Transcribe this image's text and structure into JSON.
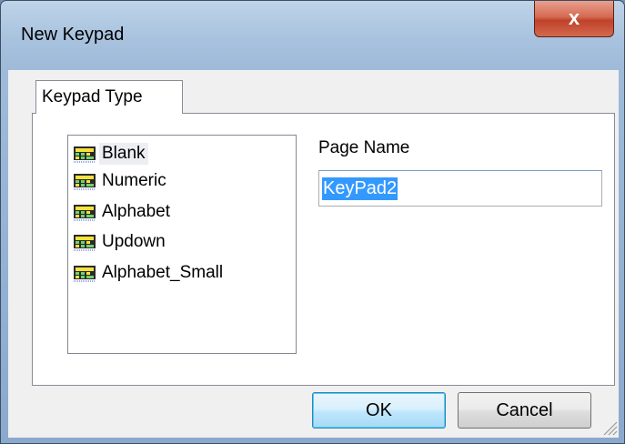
{
  "window": {
    "title": "New Keypad",
    "close_label": "x"
  },
  "tabs": [
    {
      "label": "Keypad Type",
      "selected": true
    }
  ],
  "keypad_types": {
    "items": [
      {
        "label": "Blank",
        "icon": "keypad-icon",
        "selected": true
      },
      {
        "label": "Numeric",
        "icon": "keypad-icon",
        "selected": false
      },
      {
        "label": "Alphabet",
        "icon": "keypad-icon",
        "selected": false
      },
      {
        "label": "Updown",
        "icon": "keypad-icon",
        "selected": false
      },
      {
        "label": "Alphabet_Small",
        "icon": "keypad-icon",
        "selected": false
      }
    ]
  },
  "page_name": {
    "label": "Page Name",
    "value": "KeyPad2"
  },
  "buttons": {
    "ok": "OK",
    "cancel": "Cancel"
  },
  "colors": {
    "selection_highlight": "#3399ff",
    "close_button": "#c74a33",
    "default_button_border": "#3c7fb1"
  }
}
